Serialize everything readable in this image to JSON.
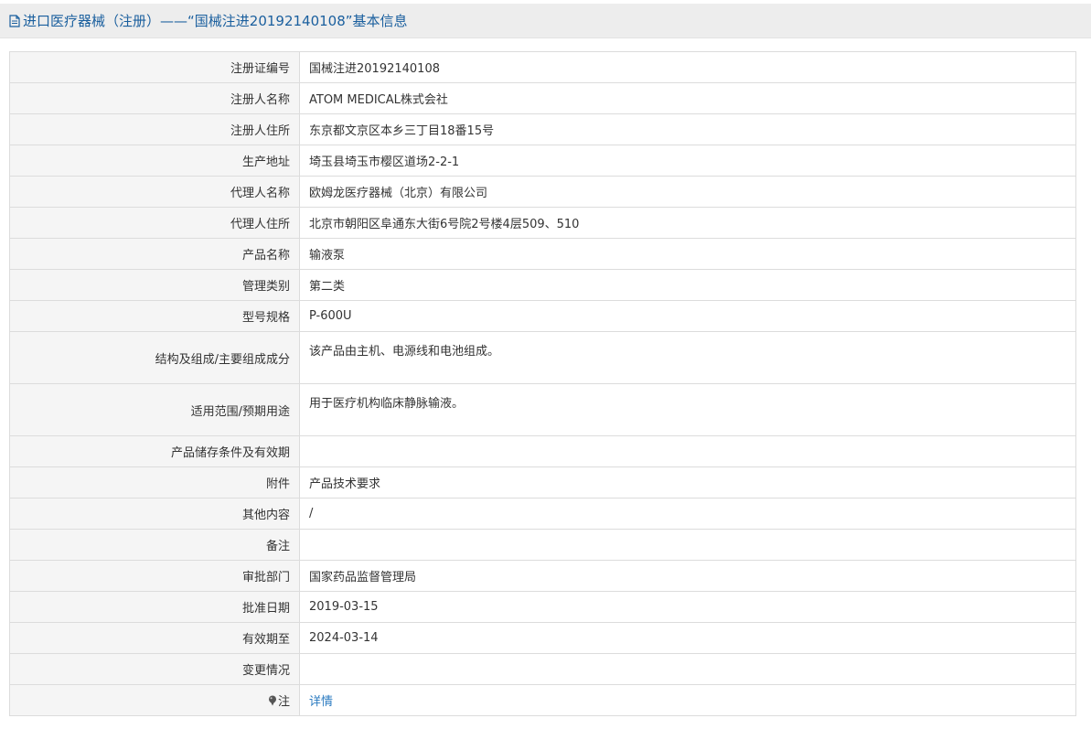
{
  "header": {
    "title": "进口医疗器械（注册）——“国械注进20192140108”基本信息"
  },
  "rows": [
    {
      "label": "注册证编号",
      "value": "国械注进20192140108"
    },
    {
      "label": "注册人名称",
      "value": "ATOM MEDICAL株式会社"
    },
    {
      "label": "注册人住所",
      "value": "东京都文京区本乡三丁目18番15号"
    },
    {
      "label": "生产地址",
      "value": "埼玉县埼玉市樱区道场2-2-1"
    },
    {
      "label": "代理人名称",
      "value": "欧姆龙医疗器械（北京）有限公司"
    },
    {
      "label": "代理人住所",
      "value": "北京市朝阳区阜通东大街6号院2号楼4层509、510"
    },
    {
      "label": "产品名称",
      "value": "输液泵"
    },
    {
      "label": "管理类别",
      "value": "第二类"
    },
    {
      "label": "型号规格",
      "value": "P-600U"
    },
    {
      "label": "结构及组成/主要组成成分",
      "value": "该产品由主机、电源线和电池组成。"
    },
    {
      "label": "适用范围/预期用途",
      "value": "用于医疗机构临床静脉输液。"
    },
    {
      "label": "产品储存条件及有效期",
      "value": ""
    },
    {
      "label": "附件",
      "value": "产品技术要求"
    },
    {
      "label": "其他内容",
      "value": "/"
    },
    {
      "label": "备注",
      "value": ""
    },
    {
      "label": "审批部门",
      "value": "国家药品监督管理局"
    },
    {
      "label": "批准日期",
      "value": "2019-03-15"
    },
    {
      "label": "有效期至",
      "value": "2024-03-14"
    },
    {
      "label": "变更情况",
      "value": ""
    },
    {
      "label": "注",
      "value": "详情",
      "icon": "pin-icon"
    }
  ],
  "colors": {
    "title_text": "#1a5f9e",
    "link": "#2a7ac0",
    "label_bg": "#f5f5f5",
    "border": "#dcdcdc"
  }
}
